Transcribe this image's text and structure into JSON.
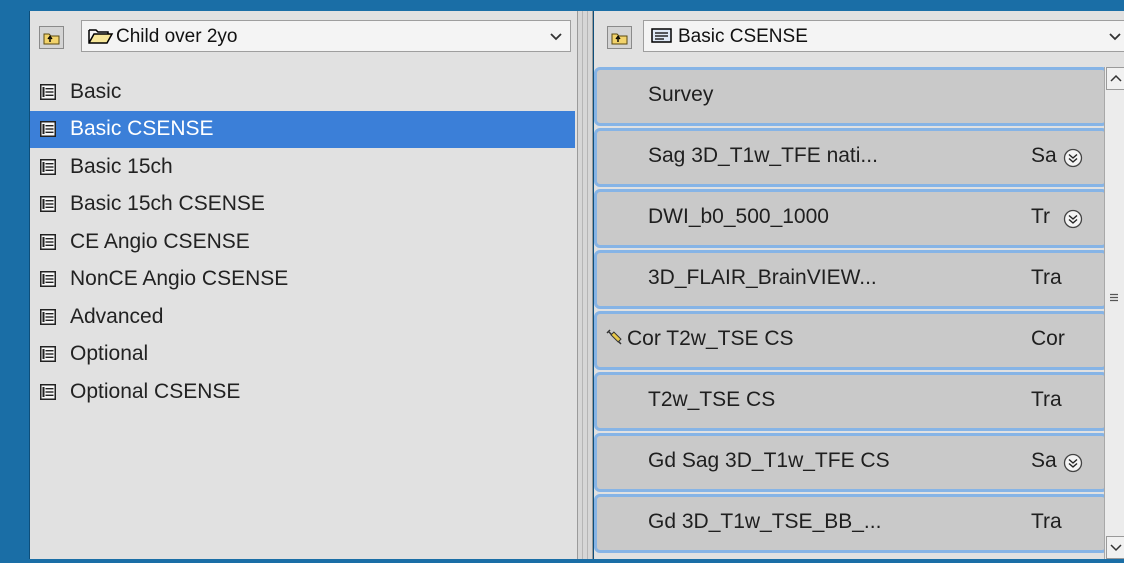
{
  "left_panel": {
    "combo": {
      "icon": "open-folder-icon",
      "value": "Child over 2yo"
    },
    "items": [
      {
        "label": "Basic",
        "icon": "list-card-icon"
      },
      {
        "label": "Basic CSENSE",
        "icon": "list-card-icon",
        "selected": true
      },
      {
        "label": "Basic 15ch",
        "icon": "list-card-icon"
      },
      {
        "label": "Basic 15ch CSENSE",
        "icon": "list-card-icon"
      },
      {
        "label": "CE Angio CSENSE",
        "icon": "list-card-icon"
      },
      {
        "label": "NonCE Angio CSENSE",
        "icon": "list-card-icon"
      },
      {
        "label": "Advanced",
        "icon": "list-card-icon"
      },
      {
        "label": "Optional",
        "icon": "list-card-icon"
      },
      {
        "label": "Optional CSENSE",
        "icon": "list-card-icon"
      }
    ]
  },
  "right_panel": {
    "combo": {
      "icon": "exam-card-icon",
      "value": "Basic CSENSE"
    },
    "sequences": [
      {
        "name": "Survey",
        "orientation": ""
      },
      {
        "name": "Sag  3D_T1w_TFE  nati...",
        "orientation": "Sa",
        "expand": true
      },
      {
        "name": "DWI_b0_500_1000",
        "orientation": "Tr",
        "expand": true
      },
      {
        "name": "3D_FLAIR_BrainVIEW...",
        "orientation": "Tra"
      },
      {
        "name": "Cor T2w_TSE CS",
        "orientation": "Cor",
        "tool": "syringe-icon"
      },
      {
        "name": "T2w_TSE CS",
        "orientation": "Tra"
      },
      {
        "name": "Gd Sag 3D_T1w_TFE CS",
        "orientation": "Sa",
        "expand": true
      },
      {
        "name": "Gd  3D_T1w_TSE_BB_...",
        "orientation": "Tra"
      }
    ]
  },
  "colors": {
    "background": "#1a6ea6",
    "panel": "#e1e1e1",
    "selection": "#3b7fd8",
    "sequence_fill": "#c9c9c9",
    "sequence_border": "#86b4e6"
  }
}
